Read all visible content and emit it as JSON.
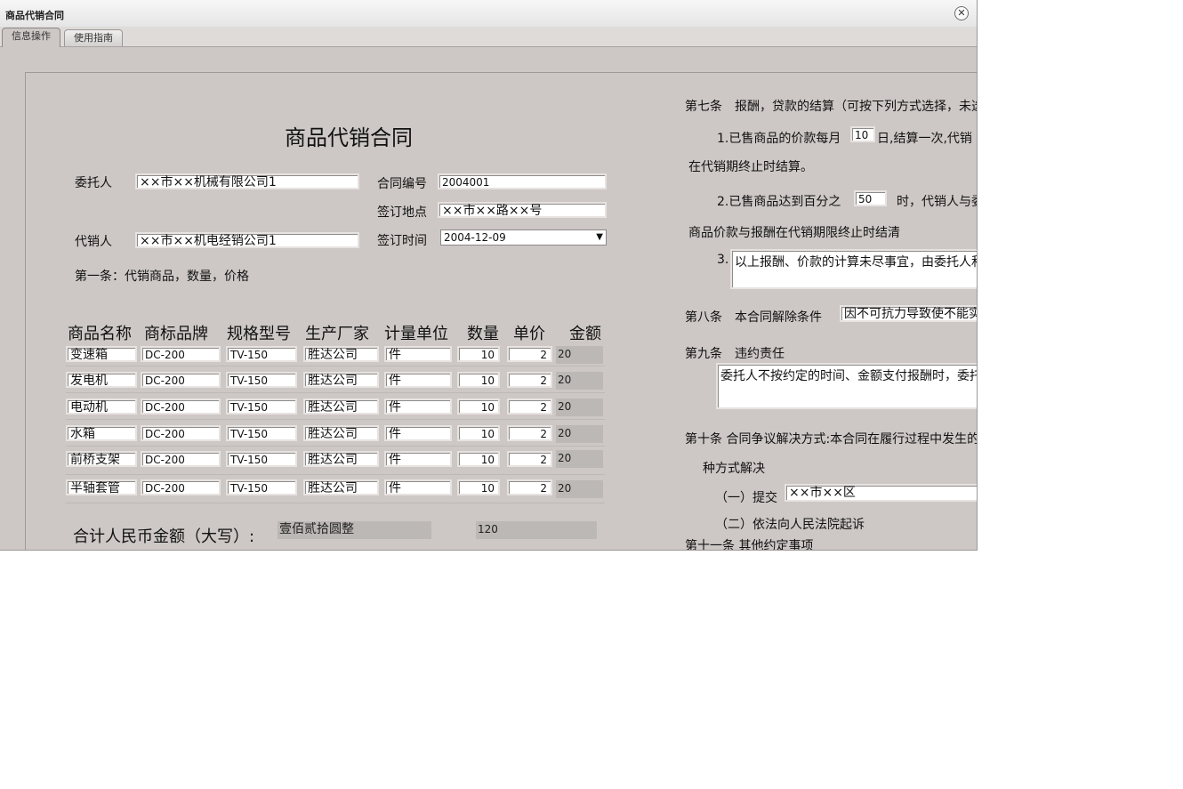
{
  "window": {
    "title": "商品代销合同"
  },
  "tabs": [
    {
      "label": "信息操作",
      "active": true
    },
    {
      "label": "使用指南",
      "active": false
    }
  ],
  "form": {
    "heading": "商品代销合同",
    "principal_label": "委托人",
    "principal_value": "××市××机械有限公司1",
    "agent_label": "代销人",
    "agent_value": "××市××机电经销公司1",
    "contract_no_label": "合同编号",
    "contract_no_value": "2004001",
    "sign_place_label": "签订地点",
    "sign_place_value": "××市××路××号",
    "sign_date_label": "签订时间",
    "sign_date_value": "2004-12-09",
    "article1": "第一条：代销商品，数量，价格"
  },
  "table": {
    "columns": [
      "商品名称",
      "商标品牌",
      "规格型号",
      "生产厂家",
      "计量单位",
      "数量",
      "单价",
      "金额"
    ],
    "rows": [
      {
        "name": "变速箱",
        "brand": "DC-200",
        "model": "TV-150",
        "maker": "胜达公司",
        "unit": "件",
        "qty": "10",
        "price": "2",
        "amount": "20"
      },
      {
        "name": "发电机",
        "brand": "DC-200",
        "model": "TV-150",
        "maker": "胜达公司",
        "unit": "件",
        "qty": "10",
        "price": "2",
        "amount": "20"
      },
      {
        "name": "电动机",
        "brand": "DC-200",
        "model": "TV-150",
        "maker": "胜达公司",
        "unit": "件",
        "qty": "10",
        "price": "2",
        "amount": "20"
      },
      {
        "name": "水箱",
        "brand": "DC-200",
        "model": "TV-150",
        "maker": "胜达公司",
        "unit": "件",
        "qty": "10",
        "price": "2",
        "amount": "20"
      },
      {
        "name": "前桥支架",
        "brand": "DC-200",
        "model": "TV-150",
        "maker": "胜达公司",
        "unit": "件",
        "qty": "10",
        "price": "2",
        "amount": "20"
      },
      {
        "name": "半轴套管",
        "brand": "DC-200",
        "model": "TV-150",
        "maker": "胜达公司",
        "unit": "件",
        "qty": "10",
        "price": "2",
        "amount": "20"
      }
    ],
    "total_label": "合计人民币金额（大写）:",
    "total_words": "壹佰贰拾圆整",
    "total_number": "120"
  },
  "right": {
    "art7": "第七条　报酬，贷款的结算（可按下列方式选择，未选",
    "art7_1a": "1.已售商品的价款每月",
    "art7_1_day": "10",
    "art7_1b": "日,结算一次,代销",
    "art7_1c": "在代销期终止时结算。",
    "art7_2a": "2.已售商品达到百分之",
    "art7_2_pct": "50",
    "art7_2b": "时，代销人与委",
    "art7_2c": "商品价款与报酬在代销期限终止时结清",
    "art7_3_num": "3.",
    "art7_3_text": "以上报酬、价款的计算未尽事宜，由委托人和",
    "art8_label": "第八条　本合同解除条件",
    "art8_value": "因不可抗力导致使不能实现",
    "art9_label": "第九条　违约责任",
    "art9_text": "委托人不按约定的时间、金额支付报酬时，委托",
    "art10": "第十条 合同争议解决方式:本合同在履行过程中发生的",
    "art10b": "种方式解决",
    "art10_opt1": "（一）提交",
    "art10_opt1_value": "××市××区",
    "art10_opt2": "（二）依法向人民法院起诉",
    "art11": "第十一条 其他约定事项"
  }
}
